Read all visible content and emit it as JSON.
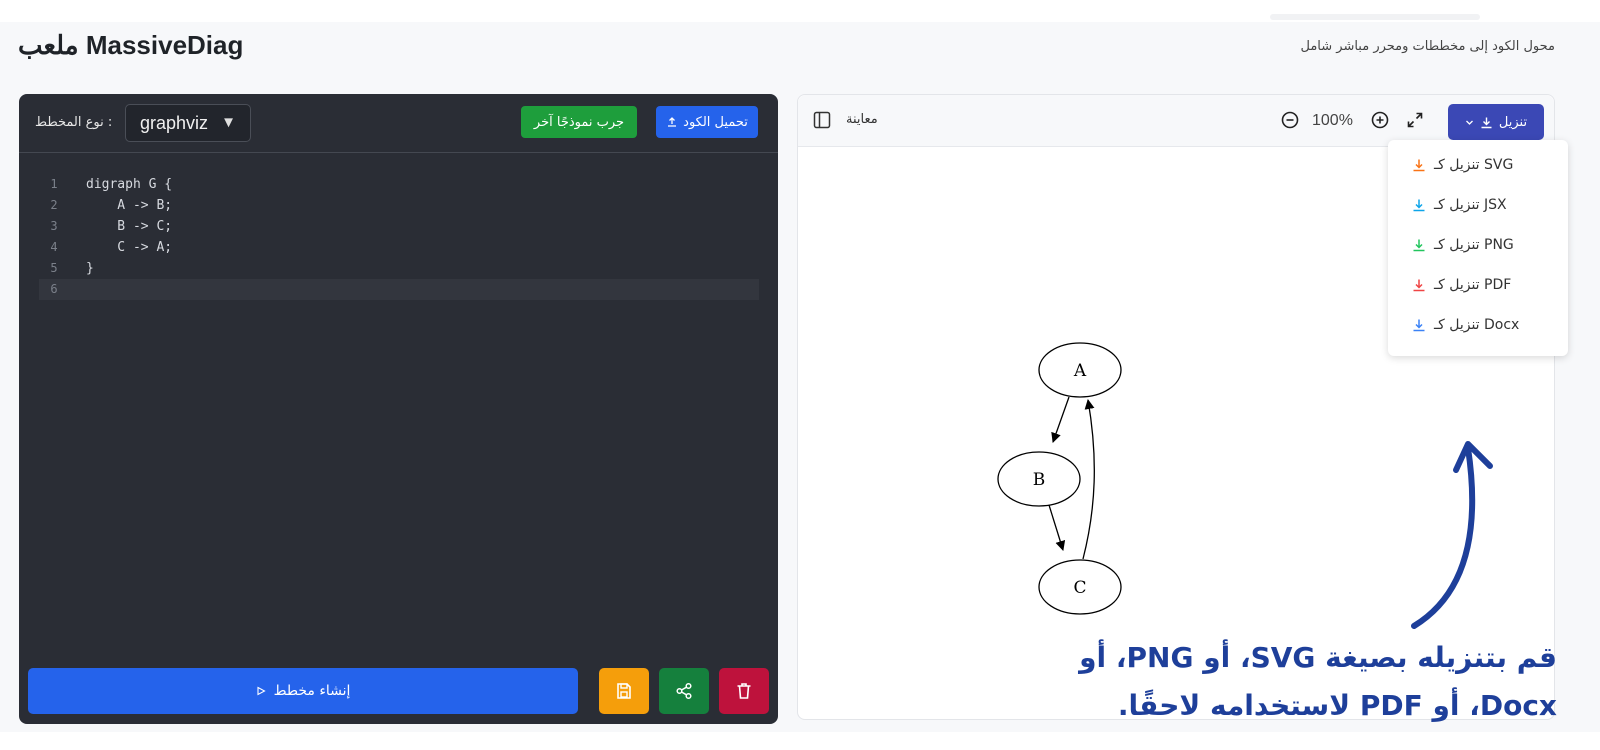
{
  "app": {
    "brand": "MassiveDiag ملعب",
    "tagline": "محول الكود إلى مخططات ومحرر مباشر شامل"
  },
  "editor": {
    "diagram_type_label": ": نوع المخطط",
    "diagram_type_value": "graphviz",
    "try_another_label": "جرب نموذجًا آخر",
    "upload_code_label": "تحميل الكود",
    "code_lines": [
      {
        "n": "1",
        "text": "digraph G {"
      },
      {
        "n": "2",
        "text": "    A -> B;"
      },
      {
        "n": "3",
        "text": "    B -> C;"
      },
      {
        "n": "4",
        "text": "    C -> A;"
      },
      {
        "n": "5",
        "text": "}"
      },
      {
        "n": "6",
        "text": ""
      }
    ],
    "generate_label": "إنشاء مخطط"
  },
  "preview": {
    "label": "معاينة",
    "zoom": "100%",
    "download_label": "تنزيل",
    "graph_nodes": [
      "A",
      "B",
      "C"
    ]
  },
  "download_menu": {
    "items": [
      {
        "label": "تنزيل كـ SVG",
        "color": "#f97316"
      },
      {
        "label": "تنزيل كـ JSX",
        "color": "#0ea5e9"
      },
      {
        "label": "تنزيل كـ PNG",
        "color": "#22c55e"
      },
      {
        "label": "تنزيل كـ PDF",
        "color": "#ef4444"
      },
      {
        "label": "تنزيل كـ Docx",
        "color": "#3b82f6"
      }
    ]
  },
  "annotation": {
    "line1": "قم بتنزيله بصيغة SVG، أو PNG، أو",
    "line2": "Docx، أو PDF لاستخدامه لاحقًا."
  },
  "colors": {
    "editor_bg": "#2a2d35",
    "primary_blue": "#2563eb",
    "green": "#1e9e3c",
    "annotation_blue": "#1e3f9a"
  }
}
